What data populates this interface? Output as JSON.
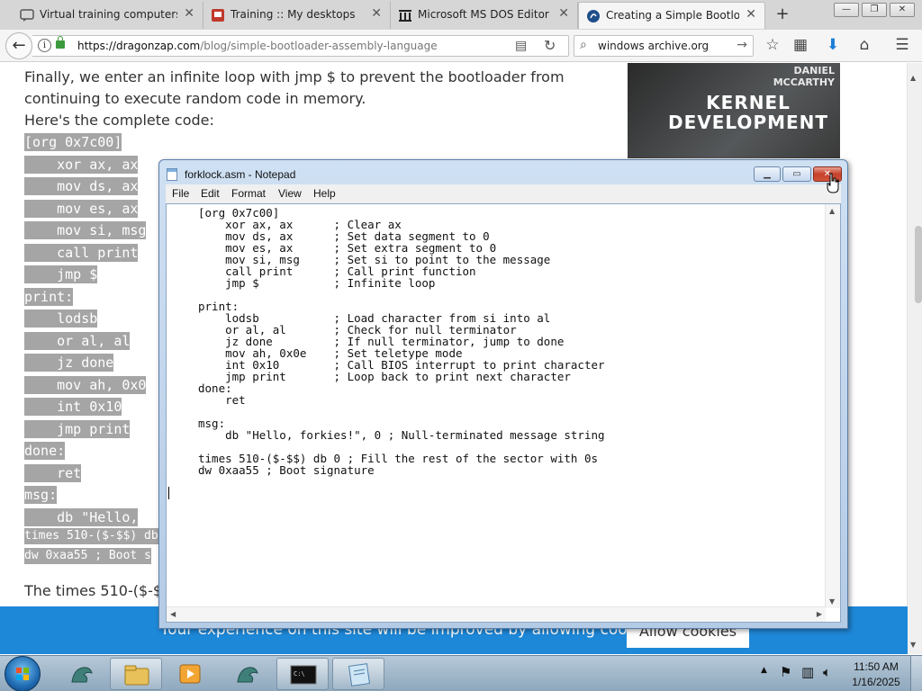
{
  "browser": {
    "tabs": [
      {
        "title": "Virtual training computers f",
        "active": false
      },
      {
        "title": "Training :: My desktops",
        "active": false
      },
      {
        "title": "Microsoft MS DOS Editor : Fr",
        "active": false
      },
      {
        "title": "Creating a Simple Bootloade",
        "active": true
      }
    ],
    "url_host": "https://dragonzap.com",
    "url_path": "/blog/simple-bootloader-assembly-language",
    "search_value": "windows archive.org",
    "window_controls": {
      "minimize": "—",
      "maximize": "❐",
      "close": "✕"
    }
  },
  "page": {
    "prose_top": [
      "Finally, we enter an infinite loop with jmp $ to prevent the bootloader from",
      "continuing to execute random code in memory.",
      "Here's the complete code:"
    ],
    "code_lines": [
      "[org 0x7c00]",
      "    xor ax, ax",
      "    mov ds, ax",
      "    mov es, ax",
      "    mov si, msg",
      "    call print",
      "    jmp $",
      "print:",
      "    lodsb",
      "    or al, al",
      "    jz done",
      "    mov ah, 0x0",
      "    int 0x10",
      "    jmp print",
      "done:",
      "    ret",
      "msg:",
      "    db \"Hello,",
      "times 510-($-$$) db",
      "dw 0xaa55 ; Boot s"
    ],
    "prose_bottom": "The times 510-($-$",
    "book_author": "DANIEL\nMCCARTHY",
    "book_title": "KERNEL\nDEVELOPMENT",
    "cookie_text": "Your experience on this site will be improved by allowing cookies.",
    "cookie_button": "Allow cookies"
  },
  "notepad": {
    "title": "forklock.asm - Notepad",
    "menu": [
      "File",
      "Edit",
      "Format",
      "View",
      "Help"
    ],
    "content": "[org 0x7c00]\n    xor ax, ax      ; Clear ax\n    mov ds, ax      ; Set data segment to 0\n    mov es, ax      ; Set extra segment to 0\n    mov si, msg     ; Set si to point to the message\n    call print      ; Call print function\n    jmp $           ; Infinite loop\n\nprint:\n    lodsb           ; Load character from si into al\n    or al, al       ; Check for null terminator\n    jz done         ; If null terminator, jump to done\n    mov ah, 0x0e    ; Set teletype mode\n    int 0x10        ; Call BIOS interrupt to print character\n    jmp print       ; Loop back to print next character\ndone:\n    ret\n\nmsg:\n    db \"Hello, forkies!\", 0 ; Null-terminated message string\n\ntimes 510-($-$$) db 0 ; Fill the rest of the sector with 0s\ndw 0xaa55 ; Boot signature"
  },
  "taskbar": {
    "time": "11:50 AM",
    "date": "1/16/2025"
  },
  "colors": {
    "cookie_bar": "#1e88d8",
    "code_highlight": "#a5a5a5",
    "notepad_frame": "#b4cbe6"
  }
}
